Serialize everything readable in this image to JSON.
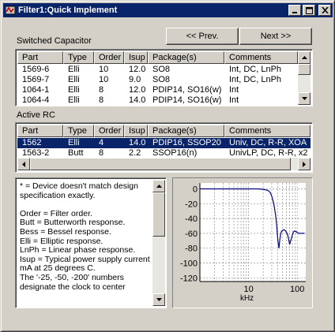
{
  "window": {
    "title": "Filter1:Quick Implement"
  },
  "titlebar_buttons": {
    "minimize": "minimize",
    "maximize": "maximize",
    "close": "close"
  },
  "nav": {
    "prev_label": "<< Prev.",
    "next_label": "Next >>"
  },
  "switched_cap": {
    "label": "Switched Capacitor",
    "columns": [
      "Part",
      "Type",
      "Order",
      "Isup",
      "Package(s)",
      "Comments"
    ],
    "rows": [
      [
        "1569-6",
        "Elli",
        "10",
        "12.0",
        "SO8",
        "Int, DC, LnPh"
      ],
      [
        "1569-7",
        "Elli",
        "10",
        "9.0",
        "SO8",
        "Int, DC, LnPh"
      ],
      [
        "1064-1",
        "Elli",
        "8",
        "12.0",
        "PDIP14, SO16(w)",
        "Int"
      ],
      [
        "1064-4",
        "Elli",
        "8",
        "14.0",
        "PDIP14, SO16(w)",
        "Int"
      ]
    ]
  },
  "active_rc": {
    "label": "Active RC",
    "columns": [
      "Part",
      "Type",
      "Order",
      "Isup",
      "Package(s)",
      "Comments"
    ],
    "rows": [
      [
        "1562",
        "Elli",
        "4",
        "14.0",
        "PDIP16, SSOP20",
        "Univ, DC, R-R, XOA"
      ],
      [
        "1563-2",
        "Butt",
        "8",
        "2.2",
        "SSOP16(n)",
        "UnivLP, DC, R-R, x2"
      ]
    ],
    "selected_row": 0
  },
  "notes": {
    "text": "* = Device doesn't match design specification exactly.\n\nOrder = Filter order.\nButt = Butterworth response.\nBess = Bessel response.\nElli = Elliptic response.\nLnPh = Linear phase response.\nIsup = Typical power supply current in mA at 25 degrees C.\nThe '-25, -50, -200' numbers designate the clock to center"
  },
  "chart_data": {
    "type": "line",
    "title": "",
    "xlabel": "kHz",
    "ylabel": "",
    "xscale": "log",
    "xlim": [
      1,
      150
    ],
    "ylim": [
      -125,
      8
    ],
    "xtick_labels": [
      "10",
      "100"
    ],
    "ytick_labels": [
      "0",
      "-20",
      "-40",
      "-60",
      "-80",
      "-100",
      "-120"
    ],
    "grid": true,
    "line_color": "#000080",
    "series": [
      {
        "x": [
          1,
          5,
          10,
          15,
          20,
          25,
          28,
          30,
          33,
          36,
          38,
          40,
          42,
          44,
          46,
          48,
          50,
          54,
          58,
          62,
          66,
          70,
          75,
          80,
          84,
          88,
          92,
          96,
          100,
          110,
          120,
          140
        ],
        "y": [
          0,
          0,
          0,
          0,
          -0.5,
          -2,
          -5,
          -10,
          -20,
          -35,
          -50,
          -70,
          -80,
          -68,
          -60,
          -57,
          -56,
          -55,
          -57,
          -60,
          -66,
          -75,
          -68,
          -62,
          -58,
          -57,
          -57,
          -58,
          -59,
          -60,
          -60,
          -60
        ]
      }
    ]
  }
}
